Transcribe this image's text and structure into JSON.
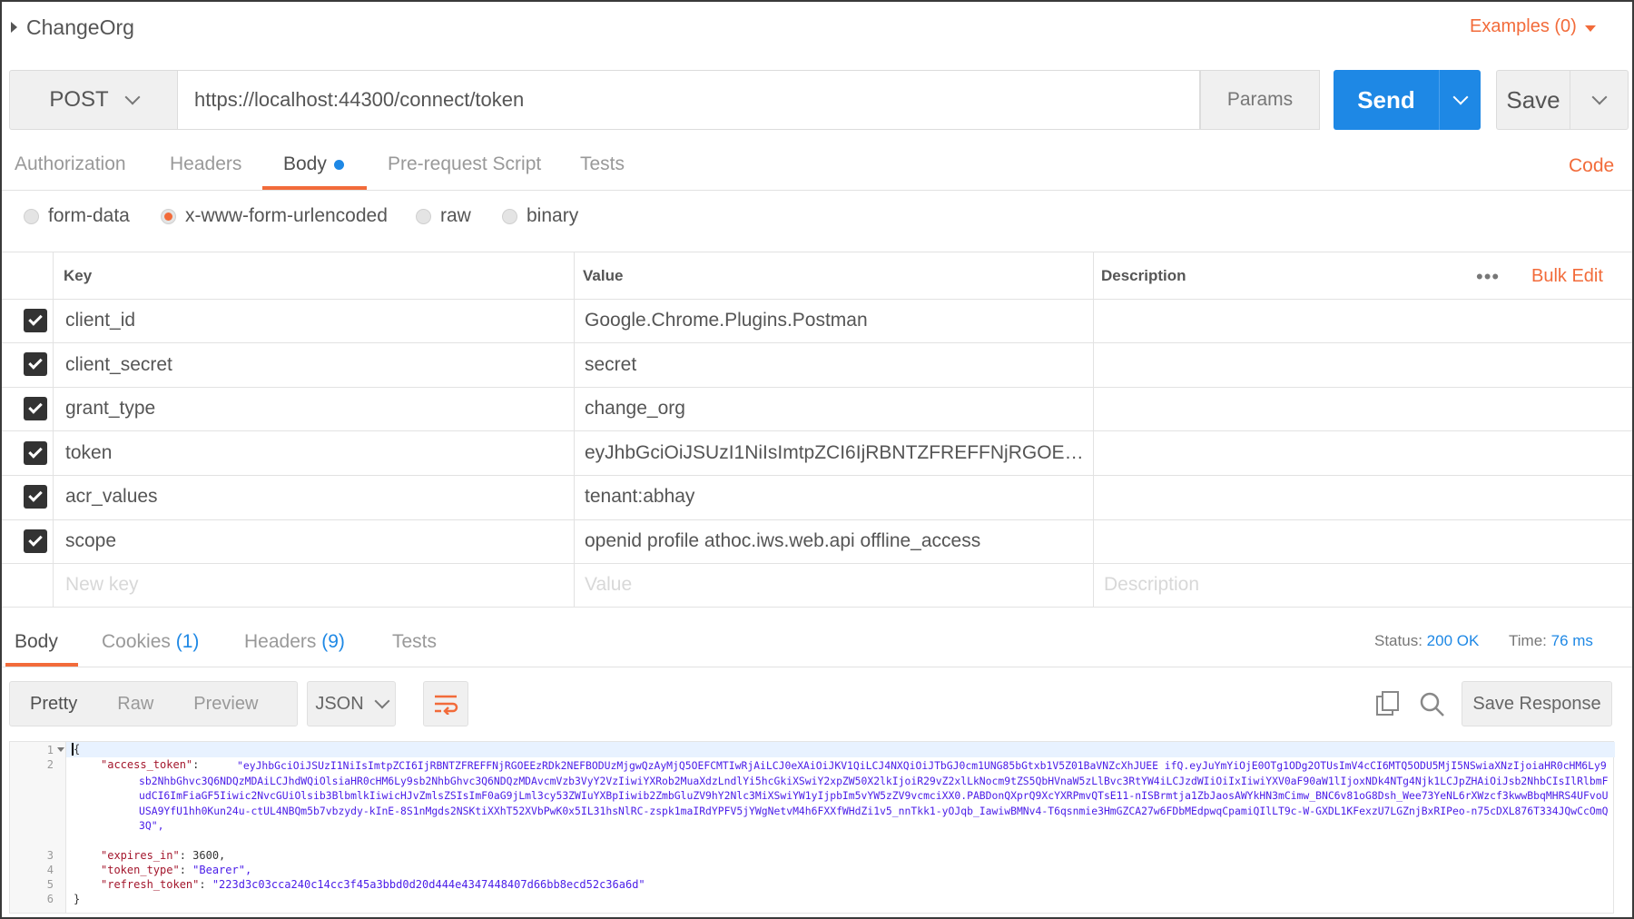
{
  "title": "ChangeOrg",
  "examples_label": "Examples (0)",
  "request": {
    "method": "POST",
    "url": "https://localhost:44300/connect/token",
    "params_label": "Params",
    "send_label": "Send",
    "save_label": "Save"
  },
  "request_tabs": [
    "Authorization",
    "Headers",
    "Body",
    "Pre-request Script",
    "Tests"
  ],
  "code_label": "Code",
  "body_modes": [
    "form-data",
    "x-www-form-urlencoded",
    "raw",
    "binary"
  ],
  "table": {
    "headers": {
      "key": "Key",
      "value": "Value",
      "description": "Description"
    },
    "bulk_edit_label": "Bulk Edit",
    "more_label": "•••",
    "rows": [
      {
        "key": "client_id",
        "value": "Google.Chrome.Plugins.Postman"
      },
      {
        "key": "client_secret",
        "value": "secret"
      },
      {
        "key": "grant_type",
        "value": "change_org"
      },
      {
        "key": "token",
        "value": "eyJhbGciOiJSUzI1NiIsImtpZCI6IjRBNTZFREFFNjRGOEEzRDk2..."
      },
      {
        "key": "acr_values",
        "value": "tenant:abhay"
      },
      {
        "key": "scope",
        "value": "openid profile athoc.iws.web.api offline_access"
      }
    ],
    "placeholders": {
      "key": "New key",
      "value": "Value",
      "description": "Description"
    }
  },
  "response": {
    "tabs": {
      "body": "Body",
      "cookies": "Cookies",
      "cookies_count": "(1)",
      "headers": "Headers",
      "headers_count": "(9)",
      "tests": "Tests"
    },
    "status_label": "Status:",
    "status_value": "200 OK",
    "time_label": "Time:",
    "time_value": "76 ms",
    "view_modes": [
      "Pretty",
      "Raw",
      "Preview"
    ],
    "format": "JSON",
    "save_response_label": "Save Response"
  },
  "json_body": {
    "line_numbers": [
      "1",
      "2",
      "3",
      "4",
      "5",
      "6"
    ],
    "open_brace": "{",
    "close_brace": "}",
    "access_token_key": "\"access_token\"",
    "access_token_value": "\"eyJhbGciOiJSUzI1NiIsImtpZCI6IjRBNTZFREFFNjRGOEEzRDk2NEFBODUzMjgwQzAyMjQ5OEFCMTIwRjAiLCJ0eXAiOiJKV1QiLCJ4NXQiOiJTbGJ0cm1UNG85bGtxb1V5Z01BaVNZcXhJUEE ifQ.eyJuYmYiOjE0OTg1ODg2OTUsImV4cCI6MTQ5ODU5MjI5NSwiaXNzIjoiaHR0cHM6Ly9sb2NhbGhvc3Q6NDQzMDAiLCJhdWQiOlsiaHR0cHM6Ly9sb2NhbGhvc3Q6NDQzMDAvcmVzb3VyY2VzIiwiYXRob2MuaXdzLndlYi5hcGkiXSwiY2xpZW50X2lkIjoiR29vZ2xlLkNocm9tZS5QbHVnaW5zLlBvc3RtYW4iLCJzdWIiOiIxIiwiYXV0aF90aW1lIjoxNDk4NTg4Njk1LCJpZHAiOiJsb2NhbCIsIlRlbmFudCI6ImFiaGF5Iiwic2NvcGUiOlsib3BlbmlkIiwicHJvZmlsZSIsImF0aG9jLml3cy53ZWIuYXBpIiwib2ZmbGluZV9hY2Nlc3MiXSwiYW1yIjpbIm5vYW5zZV9vcmciXX0.PABDonQXprQ9XcYXRPmvQTsE11-nISBrmtja1ZbJaosAWYkHN3mCimw_BNC6v81oG8Dsh_Wee73YeNL6rXWzcf3kwwBbqMHRS4UFvoUUSA9YfU1hh0Kun24u-ctUL4NBQm5b7vbzydy-kInE-8S1nMgds2NSKtiXXhT52XVbPwK0x5IL31hsNlRC-zspk1maIRdYPFV5jYWgNetvM4h6FXXfWHdZi1v5_nnTkk1-yOJqb_IawiwBMNv4-T6qsnmie3HmGZCA27w6FDbMEdpwqCpamiQIlLT9c-W-GXDL1KFexzU7LGZnjBxRIPeo-n75cDXL876T334JQwCcOmQ3Q\",",
    "expires_in_key": "\"expires_in\"",
    "expires_in_value": "3600,",
    "token_type_key": "\"token_type\"",
    "token_type_value": "\"Bearer\",",
    "refresh_token_key": "\"refresh_token\"",
    "refresh_token_value": "\"223d3c03cca240c14cc3f45a3bbd0d20d444e4347448407d66bb8ecd52c36a6d\""
  },
  "colors": {
    "accent": "#f26b3a",
    "primary": "#1e88e5"
  }
}
